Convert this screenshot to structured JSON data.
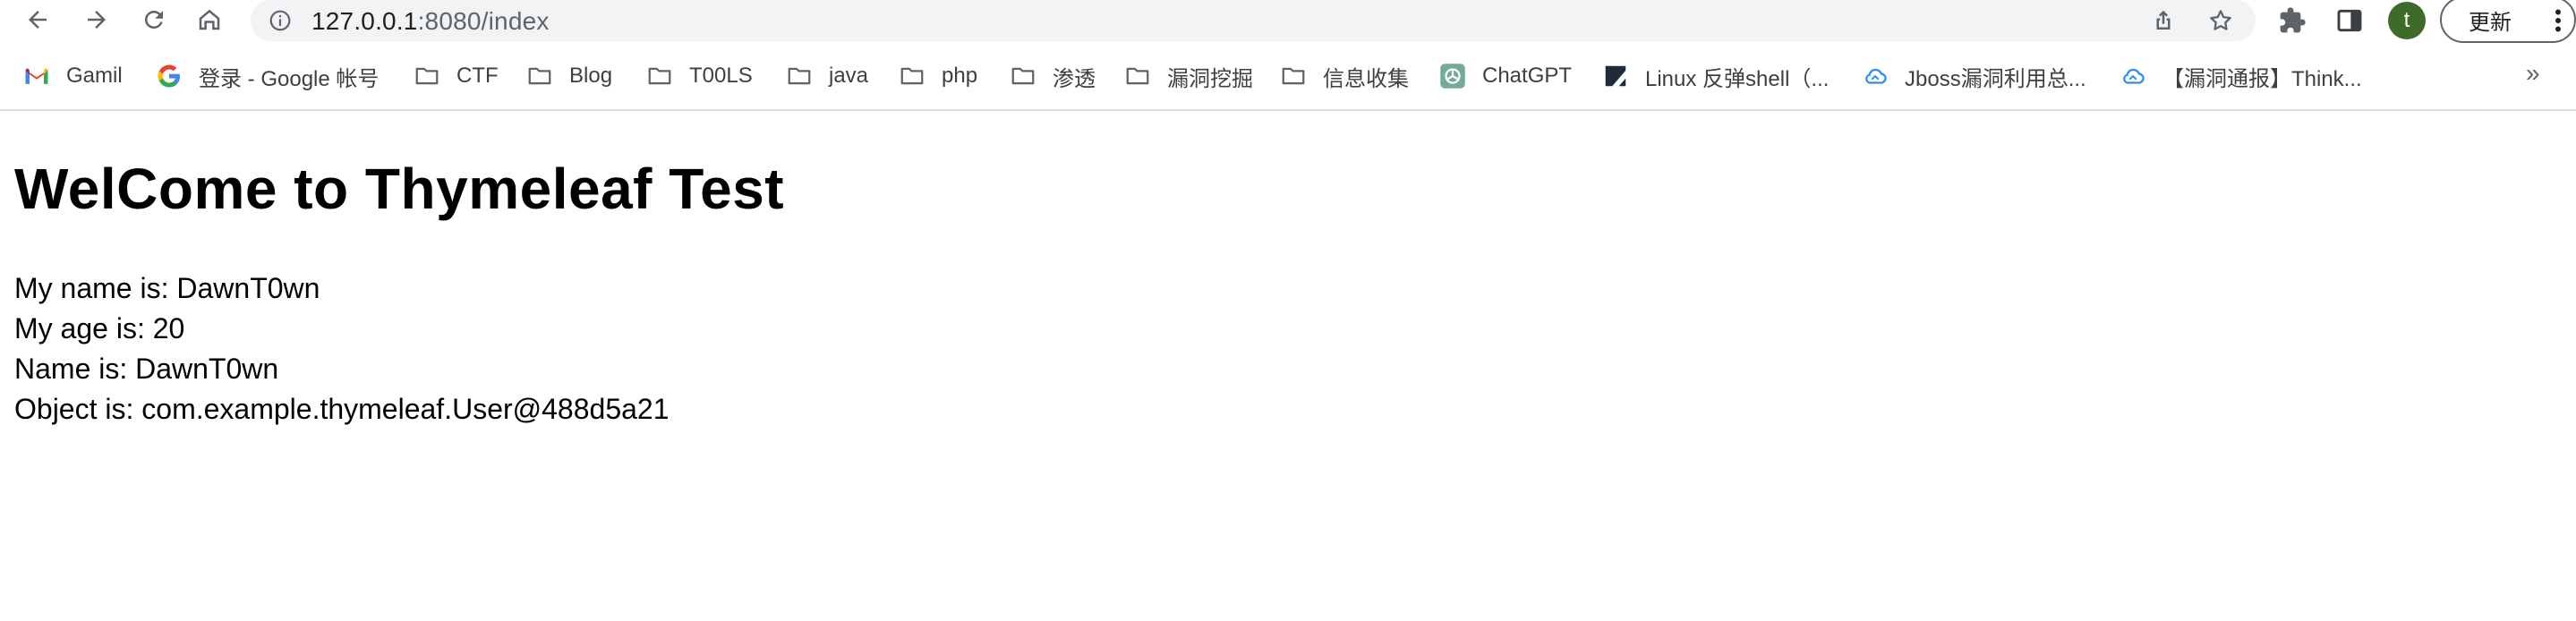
{
  "browser": {
    "url_host": "127.0.0.1",
    "url_rest": ":8080/index",
    "avatar_letter": "t",
    "update_label": "更新"
  },
  "bookmarks": [
    {
      "label": "Gamil",
      "icon": "gmail-icon"
    },
    {
      "label": "登录 - Google 帐号",
      "icon": "google-icon"
    },
    {
      "label": "CTF",
      "icon": "folder-icon"
    },
    {
      "label": "Blog",
      "icon": "folder-icon"
    },
    {
      "label": "T00LS",
      "icon": "folder-icon"
    },
    {
      "label": "java",
      "icon": "folder-icon"
    },
    {
      "label": "php",
      "icon": "folder-icon"
    },
    {
      "label": "渗透",
      "icon": "folder-icon"
    },
    {
      "label": "漏洞挖掘",
      "icon": "folder-icon"
    },
    {
      "label": "信息收集",
      "icon": "folder-icon"
    },
    {
      "label": "ChatGPT",
      "icon": "chatgpt-icon"
    },
    {
      "label": "Linux 反弹shell（...",
      "icon": "linux-site-icon"
    },
    {
      "label": "Jboss漏洞利用总...",
      "icon": "cloud-icon"
    },
    {
      "label": "【漏洞通报】Think...",
      "icon": "cloud-icon"
    }
  ],
  "more_bookmarks": "»",
  "page": {
    "heading": "WelCome to Thymeleaf Test",
    "lines": [
      "My name is: DawnT0wn",
      "My age is: 20",
      "Name is: DawnT0wn",
      "Object is: com.example.thymeleaf.User@488d5a21"
    ]
  }
}
